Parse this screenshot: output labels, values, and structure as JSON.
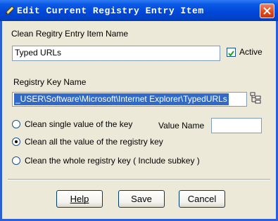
{
  "window": {
    "title": "Edit Current Registry Entry Item"
  },
  "name_section": {
    "label": "Clean Regitry Entry Item Name",
    "value": "Typed URLs",
    "active_label": "Active",
    "active_checked": true
  },
  "key_section": {
    "label": "Registry Key Name",
    "value": "_USER\\Software\\Microsoft\\Internet Explorer\\TypedURLs"
  },
  "options": {
    "single_value_label": "Clean single value of the key",
    "value_name_label": "Value Name",
    "value_name_value": "",
    "all_values_label": "Clean all the value of the registry key",
    "whole_key_label": "Clean the whole registry key ( Include subkey )",
    "selected": "all_values"
  },
  "buttons": {
    "help": "Help",
    "save": "Save",
    "cancel": "Cancel"
  }
}
